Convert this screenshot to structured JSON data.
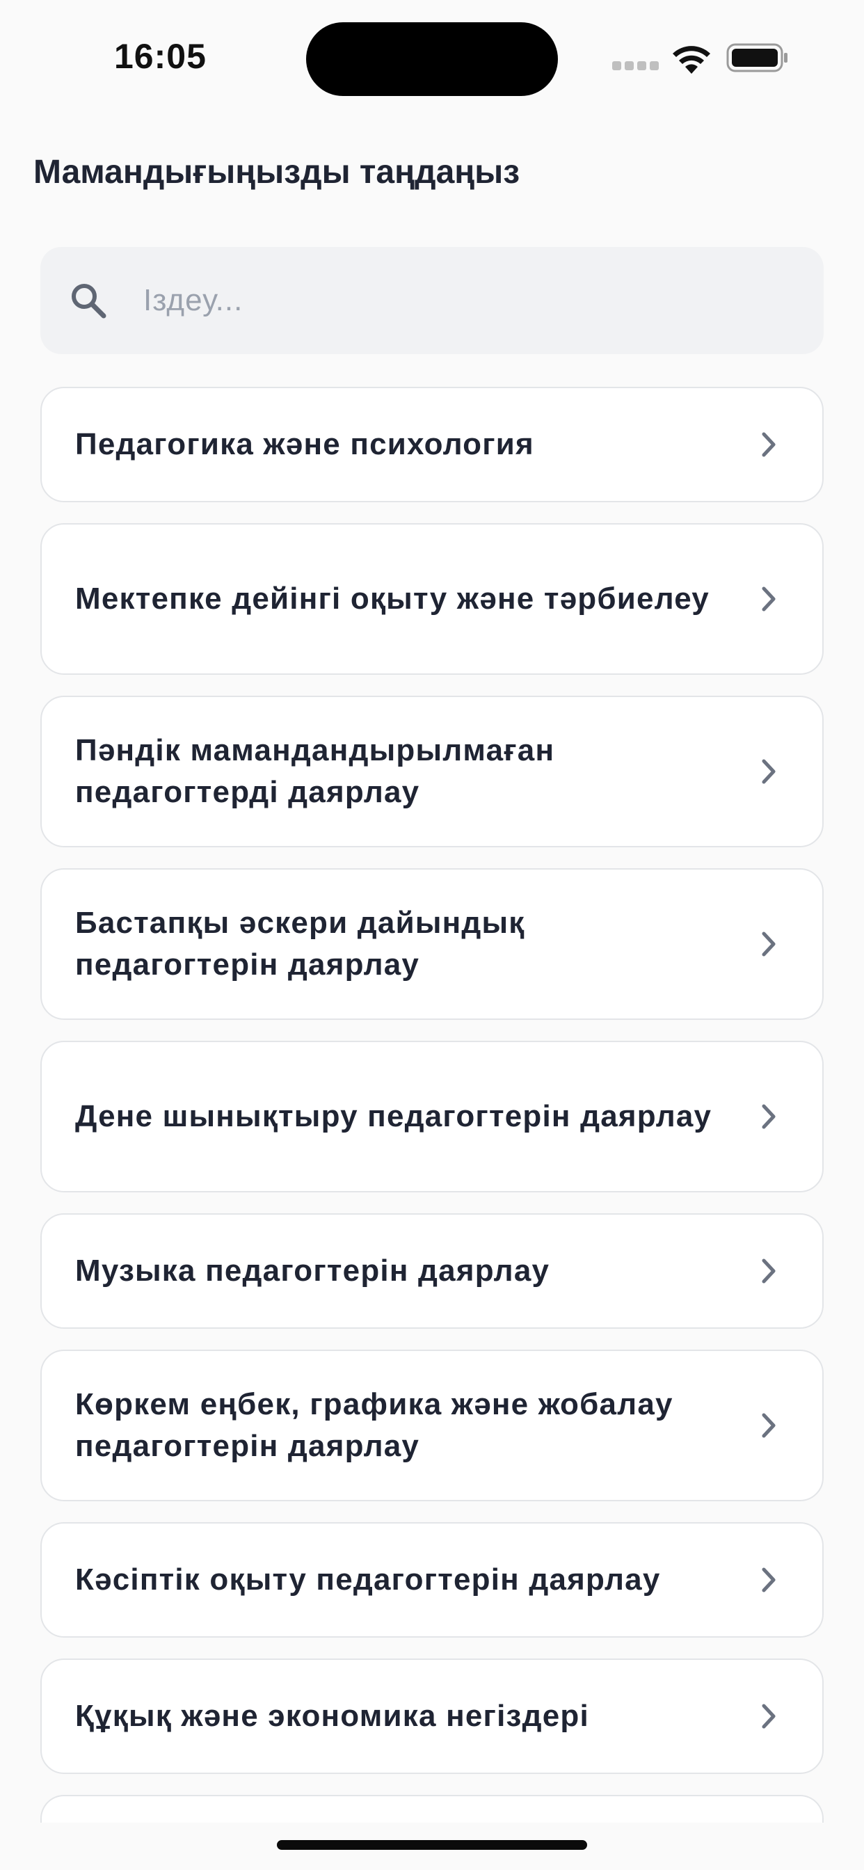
{
  "status_bar": {
    "time": "16:05"
  },
  "page": {
    "title": "Мамандығыңызды таңдаңыз"
  },
  "search": {
    "placeholder": "Іздеу..."
  },
  "specialties": [
    "Педагогика және психология",
    "Мектепке дейінгі оқыту және тәрбиелеу",
    "Пәндік мамандандырылмаған педагогтерді даярлау",
    "Бастапқы әскери дайындық педагогтерін даярлау",
    "Дене шынықтыру педагогтерін даярлау",
    "Музыка педагогтерін даярлау",
    "Көркем еңбек, графика және жобалау педагогтерін даярлау",
    "Кәсіптік оқыту педагогтерін даярлау",
    "Құқық және экономика негіздері"
  ],
  "icons": {
    "search": "search-icon",
    "chevron": "chevron-right-icon",
    "wifi": "wifi-icon",
    "battery": "battery-icon",
    "signal": "signal-icon"
  },
  "colors": {
    "background": "#fafafa",
    "card": "#ffffff",
    "card_border": "#e3e5e8",
    "text": "#1f2433",
    "search_bg": "#f1f2f4",
    "placeholder": "#9aa1ad",
    "chevron": "#6b7280"
  }
}
